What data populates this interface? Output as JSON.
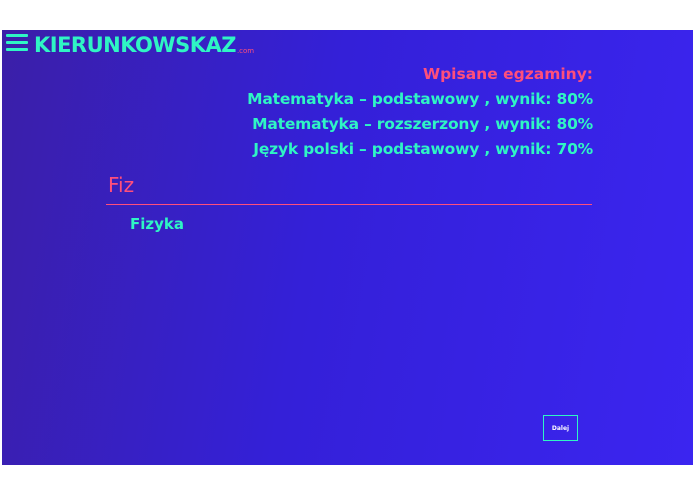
{
  "header": {
    "brand_name": "KIERUNKOWSKAZ",
    "brand_tld": ".com"
  },
  "exams": {
    "heading": "Wpisane egzaminy:",
    "items": [
      "Matematyka – podstawowy , wynik: 80%",
      "Matematyka – rozszerzony , wynik: 80%",
      "Język polski – podstawowy , wynik: 70%"
    ]
  },
  "search": {
    "value": "Fiz",
    "suggestions": [
      "Fizyka"
    ]
  },
  "footer": {
    "next_label": "Dalej"
  },
  "colors": {
    "accent_teal": "#2ff5c4",
    "accent_pink": "#ff4f7b",
    "background_start": "#3b1fa8",
    "background_end": "#3b25f0"
  }
}
